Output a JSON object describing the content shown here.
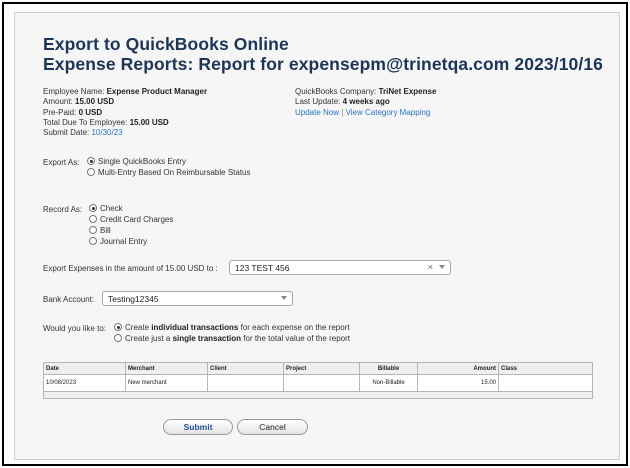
{
  "title_line1": "Export to QuickBooks Online",
  "title_line2": "Expense Reports: Report for expensepm@trinetqa.com 2023/10/16",
  "left_meta": {
    "employee_label": "Employee Name: ",
    "employee_value": "Expense Product Manager",
    "amount_label": "Amount: ",
    "amount_value": "15.00 USD",
    "prepaid_label": "Pre-Paid: ",
    "prepaid_value": "0 USD",
    "total_label": "Total Due To Employee: ",
    "total_value": "15.00 USD",
    "submit_label": "Submit Date: ",
    "submit_value": "10/30/23"
  },
  "right_meta": {
    "company_label": "QuickBooks Company: ",
    "company_value": "TriNet Expense",
    "update_label": "Last Update: ",
    "update_value": "4 weeks ago",
    "update_now_link": "Update Now",
    "separator": "|",
    "mapping_link": "View Category Mapping"
  },
  "export_as": {
    "label": "Export As:",
    "options": [
      "Single QuickBooks Entry",
      "Multi-Entry Based On Reimbursable Status"
    ],
    "selected_index": 0
  },
  "record_as": {
    "label": "Record As:",
    "options": [
      "Check",
      "Credit Card Charges",
      "Bill",
      "Journal Entry"
    ],
    "selected_index": 0
  },
  "export_expenses": {
    "label": "Export Expenses in the amount of 15.00 USD to :",
    "value": "123 TEST 456",
    "clear_symbol": "×"
  },
  "bank_account": {
    "label": "Bank Account:",
    "value": "Testing12345"
  },
  "would_you": {
    "label": "Would you like to:",
    "opt1_pre": "Create ",
    "opt1_bold": "individual transactions",
    "opt1_post": " for each expense on the report",
    "opt2_pre": "Create just a ",
    "opt2_bold": "single transaction",
    "opt2_post": " for the total value of the report",
    "selected_index": 0
  },
  "table": {
    "headers": [
      "Date",
      "Merchant",
      "Client",
      "Project",
      "Billable",
      "Amount",
      "Class"
    ],
    "row": [
      "10/08/2023",
      "New merchant",
      "",
      "",
      "Non-Billable",
      "15.00",
      ""
    ]
  },
  "buttons": {
    "submit": "Submit",
    "cancel": "Cancel"
  },
  "colors": {
    "title": "#1d3557",
    "link": "#2a72c4",
    "submit_text": "#1f4f9c"
  }
}
